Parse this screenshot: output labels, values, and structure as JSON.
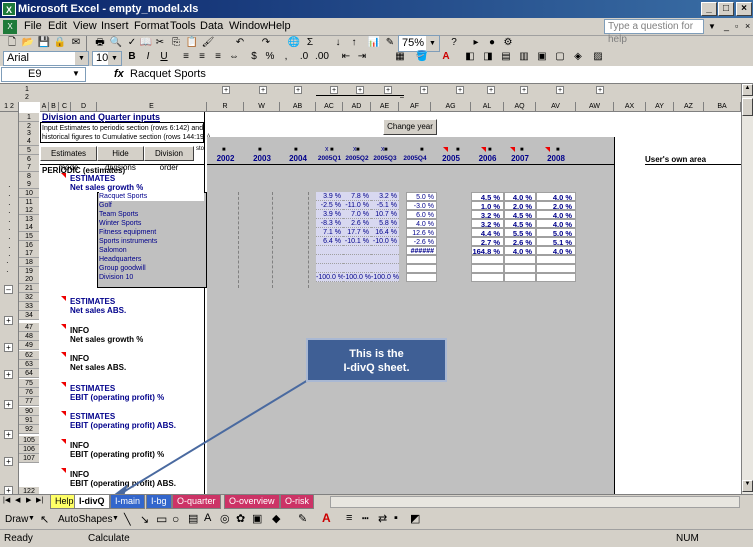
{
  "window": {
    "title": "Microsoft Excel - empty_model.xls"
  },
  "menu": {
    "items": [
      "File",
      "Edit",
      "View",
      "Insert",
      "Format",
      "Tools",
      "Data",
      "Window",
      "Help"
    ],
    "help_placeholder": "Type a question for help"
  },
  "toolbar": {
    "zoom": "75%",
    "font": "Arial",
    "size": "10"
  },
  "formula": {
    "cell": "E9",
    "fx": "fx",
    "value": "Racquet Sports"
  },
  "sheet": {
    "title": "Division and Quarter inputs",
    "note1": "Input Estimates to periodic section (rows 6:142) and",
    "note2": "historical figures to Cumulative section (rows 144:190)",
    "btn_estimates": "Estimates mode",
    "btn_hide": "Hide divisions",
    "btn_order": "Division order",
    "btn_change": "Change year",
    "col_headers": [
      "A",
      "B",
      "C",
      "D",
      "E",
      "R",
      "W",
      "AB",
      "AC",
      "AD",
      "AE",
      "AF",
      "AG",
      "AL",
      "AQ",
      "AV",
      "AW",
      "AX",
      "AY",
      "AZ",
      "BA"
    ],
    "years": [
      "2002",
      "2003",
      "2004",
      "2005Q1",
      "2005Q2",
      "2005Q3",
      "2005Q4",
      "2005",
      "2006",
      "2007",
      "2008"
    ],
    "users_area": "User's own area",
    "periodic": "PERIODIC (estimates)",
    "estimates": "ESTIMATES",
    "info": "INFO",
    "net_sales_growth": "Net sales growth %",
    "net_sales_abs": "Net sales ABS.",
    "ebit_pct": "EBIT (operating profit) %",
    "ebit_abs": "EBIT (operating profit) ABS.",
    "divisions": [
      "Racquet Sports",
      "Golf",
      "Team Sports",
      "Winter Sports",
      "Fitness equipment",
      "Sports instruments",
      "Salomon",
      "Headquarters",
      "Group goodwill",
      "Division 10"
    ],
    "q_rows": [
      [
        "3.9 %",
        "7.8 %",
        "3.2 %",
        "5.0 %"
      ],
      [
        "-2.5 %",
        "-11.0 %",
        "-5.1 %",
        "-3.0 %"
      ],
      [
        "3.9 %",
        "7.0 %",
        "10.7 %",
        "6.0 %"
      ],
      [
        "-8.3 %",
        "2.6 %",
        "5.8 %",
        "4.0 %"
      ],
      [
        "7.1 %",
        "17.7 %",
        "16.4 %",
        "12.6 %"
      ],
      [
        "6.4 %",
        "-10.1 %",
        "-10.0 %",
        "-2.6 %"
      ],
      [
        "",
        "",
        "",
        "######"
      ],
      [
        "",
        "",
        "",
        ""
      ],
      [
        "",
        "",
        "",
        ""
      ],
      [
        "-100.0 %",
        "-100.0 %",
        "-100.0 %",
        ""
      ]
    ],
    "y_rows": [
      [
        "4.5 %",
        "4.0 %",
        "4.0 %"
      ],
      [
        "1.0 %",
        "2.0 %",
        "2.0 %"
      ],
      [
        "3.2 %",
        "4.5 %",
        "4.0 %"
      ],
      [
        "3.2 %",
        "4.5 %",
        "4.0 %"
      ],
      [
        "4.4 %",
        "5.5 %",
        "5.0 %"
      ],
      [
        "2.7 %",
        "2.6 %",
        "5.1 %"
      ],
      [
        "164.8 %",
        "4.0 %",
        "4.0 %"
      ],
      [
        "",
        "",
        ""
      ],
      [
        "",
        "",
        ""
      ],
      [
        "",
        "",
        ""
      ]
    ],
    "row_numbers": [
      "1",
      "2",
      "3",
      "4",
      "5",
      "6",
      "7",
      "8",
      "9",
      "10",
      "11",
      "12",
      "13",
      "14",
      "15",
      "16",
      "17",
      "18",
      "19",
      "20",
      "21",
      "32",
      "33",
      "34",
      "47",
      "48",
      "49",
      "62",
      "63",
      "64",
      "75",
      "76",
      "77",
      "90",
      "91",
      "92",
      "105",
      "106",
      "107",
      "122"
    ],
    "xs": [
      "x",
      "x",
      "x"
    ]
  },
  "callout": {
    "line1": "This is the",
    "line2": "I-divQ sheet."
  },
  "tabs": [
    "Help",
    "I-divQ",
    "I-main",
    "I-bg",
    "O-quarter",
    "O-overview",
    "O-risk"
  ],
  "draw": {
    "draw": "Draw",
    "autoshapes": "AutoShapes"
  },
  "status": {
    "left": "Ready",
    "mid": "Calculate",
    "num": "NUM"
  }
}
